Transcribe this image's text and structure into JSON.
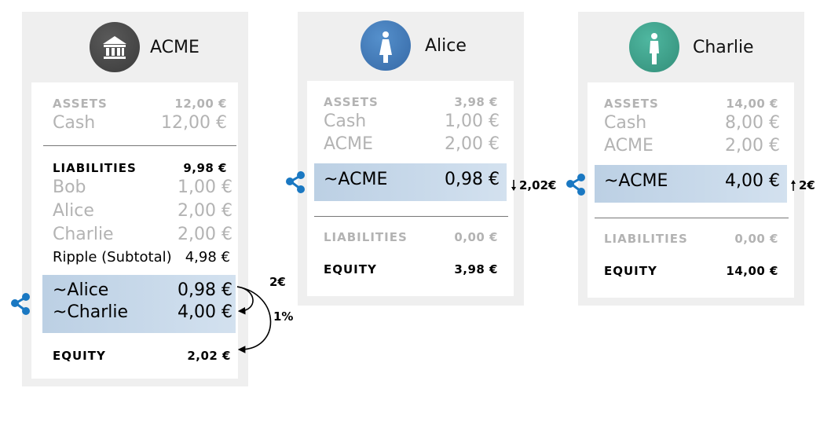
{
  "acme": {
    "name": "ACME",
    "assets": {
      "label": "ASSETS",
      "total": "12,00 €"
    },
    "cash": {
      "label": "Cash",
      "value": "12,00 €"
    },
    "liabilities": {
      "label": "LIABILITIES",
      "total": "9,98 €"
    },
    "bob": {
      "label": "Bob",
      "value": "1,00 €"
    },
    "alice": {
      "label": "Alice",
      "value": "2,00 €"
    },
    "charlie": {
      "label": "Charlie",
      "value": "2,00 €"
    },
    "ripple_subtotal": {
      "label": "Ripple (Subtotal)",
      "value": "4,98 €"
    },
    "ripple_alice": {
      "label": "~Alice",
      "value": "0,98 €"
    },
    "ripple_charlie": {
      "label": "~Charlie",
      "value": "4,00 €"
    },
    "equity": {
      "label": "EQUITY",
      "value": "2,02 €"
    },
    "arrow_2": "2€",
    "arrow_1pct": "1%"
  },
  "alice": {
    "name": "Alice",
    "assets": {
      "label": "ASSETS",
      "total": "3,98 €"
    },
    "cash": {
      "label": "Cash",
      "value": "1,00 €"
    },
    "acme": {
      "label": "ACME",
      "value": "2,00 €"
    },
    "ripple_acme": {
      "label": "~ACME",
      "value": "0,98 €"
    },
    "change": "2,02€",
    "liabilities": {
      "label": "LIABILITIES",
      "total": "0,00 €"
    },
    "equity": {
      "label": "EQUITY",
      "value": "3,98 €"
    }
  },
  "charlie": {
    "name": "Charlie",
    "assets": {
      "label": "ASSETS",
      "total": "14,00 €"
    },
    "cash": {
      "label": "Cash",
      "value": "8,00 €"
    },
    "acme": {
      "label": "ACME",
      "value": "2,00 €"
    },
    "ripple_acme": {
      "label": "~ACME",
      "value": "4,00 €"
    },
    "change": "2€",
    "liabilities": {
      "label": "LIABILITIES",
      "total": "0,00 €"
    },
    "equity": {
      "label": "EQUITY",
      "value": "14,00 €"
    }
  },
  "colors": {
    "acme_avatar": "#4a4a4a",
    "alice_avatar": "#3f78b8",
    "charlie_avatar": "#3ea38c",
    "ripple_icon": "#1a78c2",
    "highlight": "#c3d5e8"
  },
  "icons": {
    "acme": "bank-icon",
    "alice": "woman-icon",
    "charlie": "man-icon",
    "ripple": "ripple-icon"
  }
}
